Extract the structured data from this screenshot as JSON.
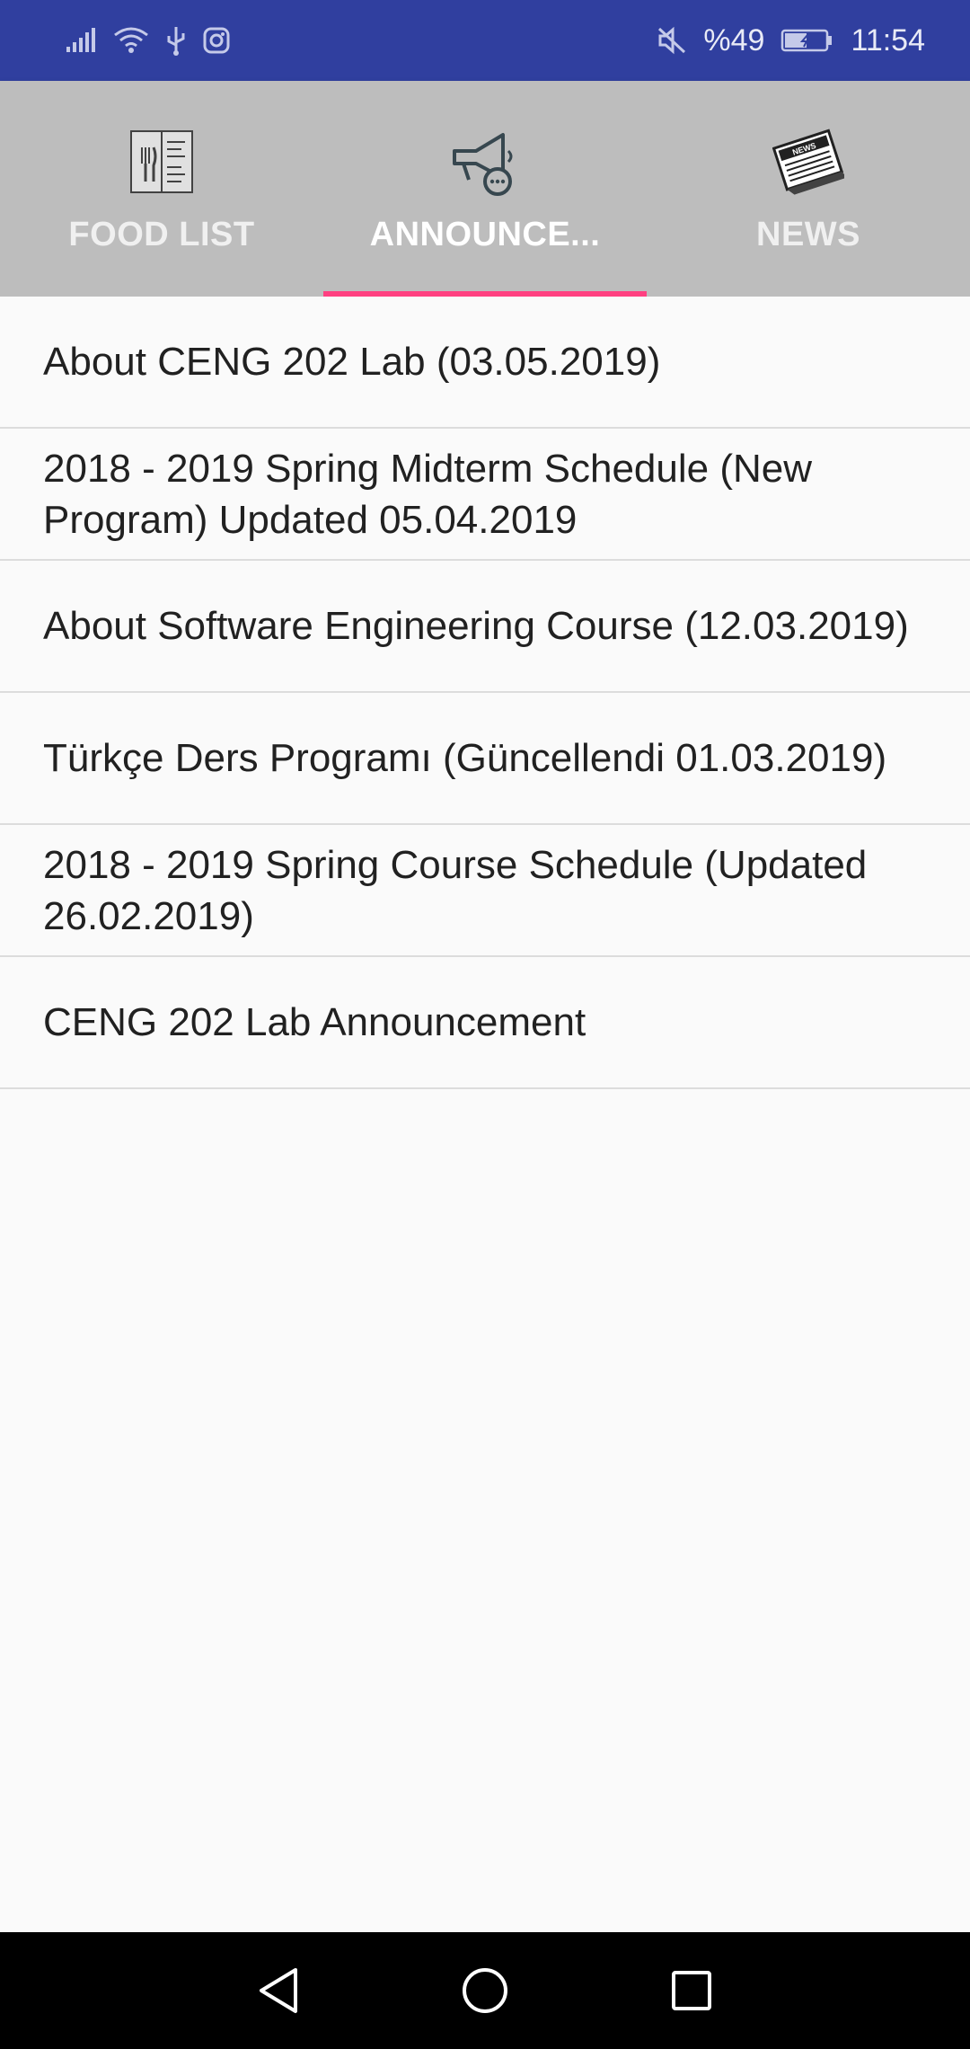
{
  "status_bar": {
    "battery_text": "%49",
    "time": "11:54",
    "icons_left": [
      "signal-icon",
      "wifi-icon",
      "usb-icon",
      "instagram-icon"
    ],
    "icons_right": [
      "mute-icon",
      "battery-icon"
    ]
  },
  "tabs": [
    {
      "label": "FOOD LIST",
      "icon": "food-menu-icon",
      "active": false
    },
    {
      "label": "ANNOUNCE...",
      "icon": "megaphone-icon",
      "active": true
    },
    {
      "label": "NEWS",
      "icon": "newspaper-icon",
      "active": false
    }
  ],
  "announcements": [
    "About CENG 202 Lab (03.05.2019)",
    "2018 - 2019 Spring Midterm Schedule (New Program) Updated 05.04.2019",
    "About Software Engineering Course (12.03.2019)",
    "Türkçe Ders Programı (Güncellendi 01.03.2019)",
    "2018 - 2019 Spring Course Schedule (Updated 26.02.2019)",
    "CENG 202 Lab Announcement"
  ],
  "nav_bar": {
    "buttons": [
      "back-icon",
      "home-icon",
      "recents-icon"
    ]
  },
  "colors": {
    "status_bar": "#303f9f",
    "tab_bar": "#bdbdbd",
    "indicator": "#ff4081",
    "background": "#fafafa"
  }
}
